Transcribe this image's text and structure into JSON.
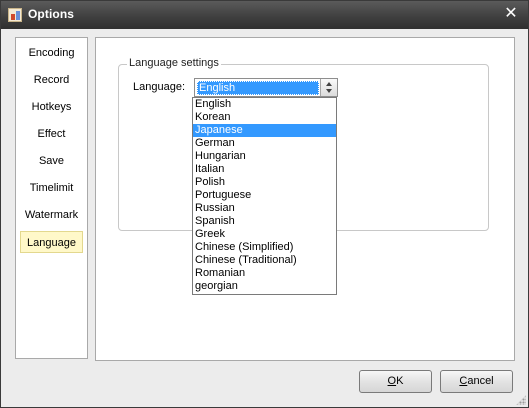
{
  "window": {
    "title": "Options",
    "close_glyph": "✕"
  },
  "nav": {
    "items": [
      {
        "label": "Encoding",
        "selected": false
      },
      {
        "label": "Record",
        "selected": false
      },
      {
        "label": "Hotkeys",
        "selected": false
      },
      {
        "label": "Effect",
        "selected": false
      },
      {
        "label": "Save",
        "selected": false
      },
      {
        "label": "Timelimit",
        "selected": false
      },
      {
        "label": "Watermark",
        "selected": false
      },
      {
        "label": "Language",
        "selected": true
      }
    ]
  },
  "language_settings": {
    "group_title": "Language settings",
    "label": "Language:",
    "selected_value": "English",
    "options": [
      "English",
      "Korean",
      "Japanese",
      "German",
      "Hungarian",
      "Italian",
      "Polish",
      "Portuguese",
      "Russian",
      "Spanish",
      "Greek",
      "Chinese (Simplified)",
      "Chinese (Traditional)",
      "Romanian",
      "georgian"
    ],
    "hovered_option": "Japanese"
  },
  "buttons": {
    "ok": {
      "mnemonic": "O",
      "rest": "K"
    },
    "cancel": {
      "mnemonic": "C",
      "rest": "ancel"
    }
  },
  "colors": {
    "selection_blue": "#3399ff",
    "nav_selected_bg": "#fff8c9",
    "titlebar_dark": "#404040"
  }
}
